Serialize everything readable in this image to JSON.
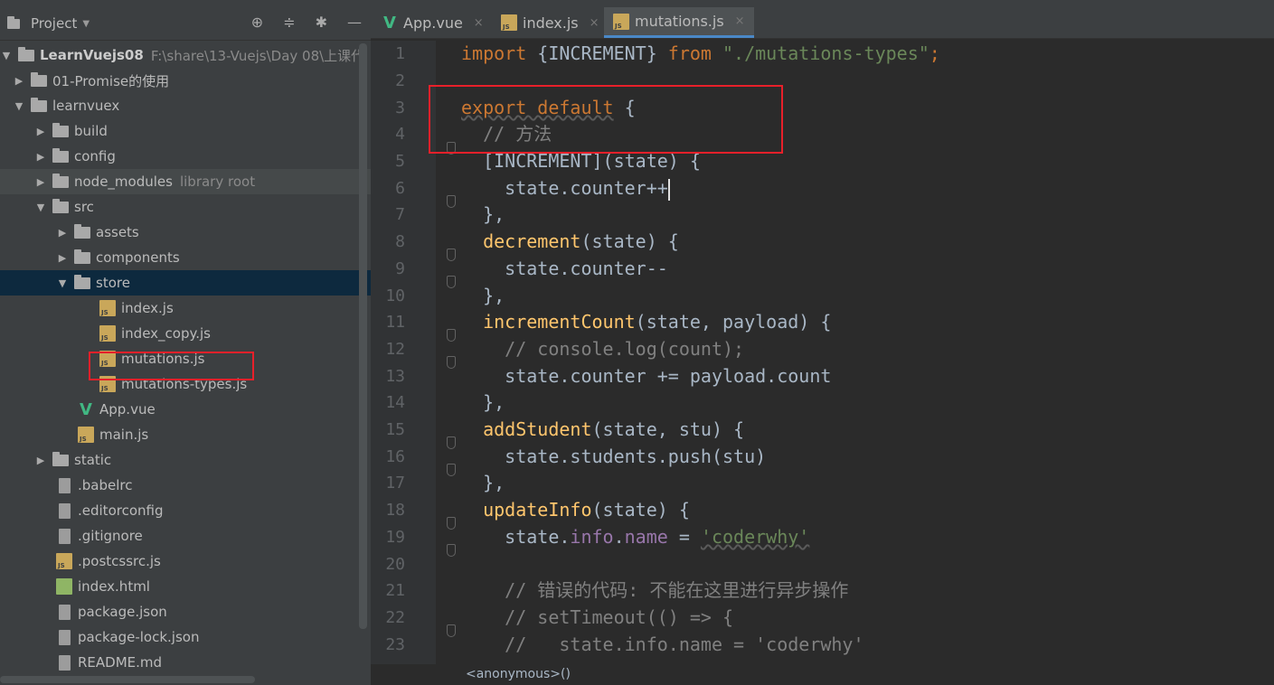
{
  "project_panel": {
    "title": "Project",
    "root_name": "LearnVuejs08",
    "root_path": "F:\\share\\13-Vuejs\\Day 08\\上课代",
    "items": [
      {
        "label": "01-Promise的使用",
        "type": "folder"
      },
      {
        "label": "learnvuex",
        "type": "folder"
      },
      {
        "label": "build",
        "type": "folder"
      },
      {
        "label": "config",
        "type": "folder"
      },
      {
        "label": "node_modules",
        "type": "folder",
        "note": "library root"
      },
      {
        "label": "src",
        "type": "folder"
      },
      {
        "label": "assets",
        "type": "folder"
      },
      {
        "label": "components",
        "type": "folder"
      },
      {
        "label": "store",
        "type": "folder"
      },
      {
        "label": "index.js",
        "type": "js"
      },
      {
        "label": "index_copy.js",
        "type": "js"
      },
      {
        "label": "mutations.js",
        "type": "js"
      },
      {
        "label": "mutations-types.js",
        "type": "js"
      },
      {
        "label": "App.vue",
        "type": "vue"
      },
      {
        "label": "main.js",
        "type": "js"
      },
      {
        "label": "static",
        "type": "folder"
      },
      {
        "label": ".babelrc",
        "type": "file"
      },
      {
        "label": ".editorconfig",
        "type": "file"
      },
      {
        "label": ".gitignore",
        "type": "file"
      },
      {
        "label": ".postcssrc.js",
        "type": "js"
      },
      {
        "label": "index.html",
        "type": "html"
      },
      {
        "label": "package.json",
        "type": "file"
      },
      {
        "label": "package-lock.json",
        "type": "file"
      },
      {
        "label": "README.md",
        "type": "file"
      }
    ]
  },
  "tabs": [
    {
      "label": "App.vue"
    },
    {
      "label": "index.js"
    },
    {
      "label": "mutations.js"
    }
  ],
  "code": {
    "line_numbers": [
      "1",
      "2",
      "3",
      "4",
      "5",
      "6",
      "7",
      "8",
      "9",
      "10",
      "11",
      "12",
      "13",
      "14",
      "15",
      "16",
      "17",
      "18",
      "19",
      "20",
      "21",
      "22",
      "23"
    ],
    "l1_import": "import",
    "l1_names": " {INCREMENT} ",
    "l1_from": "from",
    "l1_path": "\"./mutations-types\"",
    "l1_semi": ";",
    "l3_export": "export default",
    "l3_rest": " {",
    "l4": "  // 方法",
    "l5": "  [INCREMENT](state) {",
    "l6": "    state.counter++",
    "l7": "  },",
    "l8_fn": "decrement",
    "l8_rest": "(state) {",
    "l9": "    state.counter--",
    "l10": "  },",
    "l11_fn": "incrementCount",
    "l11_rest": "(state, payload) {",
    "l12": "    // console.log(count);",
    "l13": "    state.counter += payload.count",
    "l14": "  },",
    "l15_fn": "addStudent",
    "l15_rest": "(state, stu) {",
    "l16": "    state.students.push(stu)",
    "l17": "  },",
    "l18_fn": "updateInfo",
    "l18_rest": "(state) {",
    "l19_a": "    state.",
    "l19_b": "info",
    "l19_c": ".",
    "l19_d": "name",
    "l19_e": " = ",
    "l19_f": "'coderwhy'",
    "l21": "    // 错误的代码: 不能在这里进行异步操作",
    "l22": "    // setTimeout(() => {",
    "l23": "    //   state.info.name = 'coderwhy'"
  },
  "status_bar": {
    "text": "<anonymous>()"
  }
}
